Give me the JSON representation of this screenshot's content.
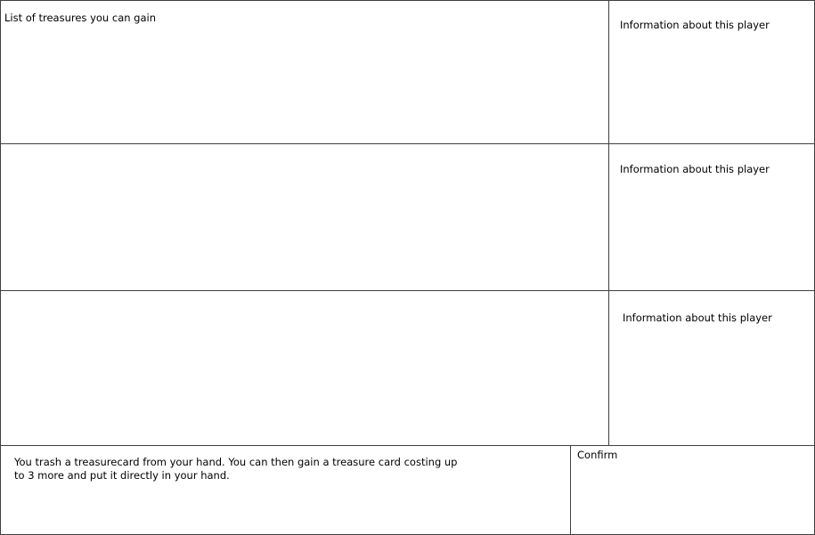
{
  "treasure_list": {
    "label": "List of treasures you can gain"
  },
  "players": [
    {
      "info_label": "Information about this player"
    },
    {
      "info_label": "Information about this player"
    },
    {
      "info_label": "Information about this player"
    }
  ],
  "action": {
    "description": "You trash a treasurecard from your hand. You can then gain a treasure card costing up to 3 more and put it directly in your hand."
  },
  "confirm": {
    "label": "Confirm"
  }
}
